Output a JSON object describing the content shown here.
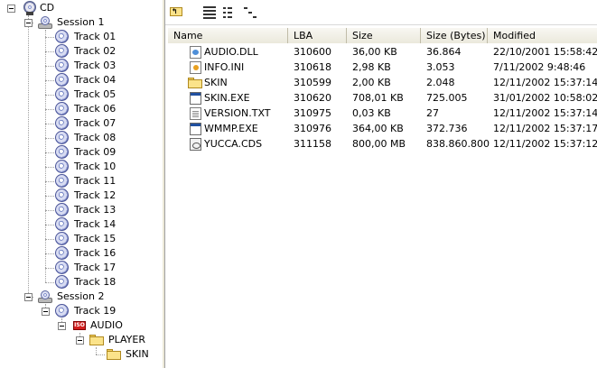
{
  "tree": {
    "root_label": "CD",
    "session1_label": "Session 1",
    "tracks": [
      "Track 01",
      "Track 02",
      "Track 03",
      "Track 04",
      "Track 05",
      "Track 06",
      "Track 07",
      "Track 08",
      "Track 09",
      "Track 10",
      "Track 11",
      "Track 12",
      "Track 13",
      "Track 14",
      "Track 15",
      "Track 16",
      "Track 17",
      "Track 18"
    ],
    "session2_label": "Session 2",
    "track19_label": "Track 19",
    "iso_badge": "ISO",
    "audio_label": "AUDIO",
    "player_label": "PLAYER",
    "skin_label": "SKIN"
  },
  "toolbar": {
    "up_icon": "folder-up-icon",
    "details_icon": "details-view-icon",
    "list_icon": "list-view-icon",
    "tree_icon": "tree-view-icon"
  },
  "columns": [
    "Name",
    "LBA",
    "Size",
    "Size (Bytes)",
    "Modified"
  ],
  "files": [
    {
      "name": "AUDIO.DLL",
      "lba": "310600",
      "size": "36,00 KB",
      "bytes": "36.864",
      "modified": "22/10/2001 15:58:42",
      "icon": "dll"
    },
    {
      "name": "INFO.INI",
      "lba": "310618",
      "size": "2,98 KB",
      "bytes": "3.053",
      "modified": "7/11/2002 9:48:46",
      "icon": "ini"
    },
    {
      "name": "SKIN",
      "lba": "310599",
      "size": "2,00 KB",
      "bytes": "2.048",
      "modified": "12/11/2002 15:37:14",
      "icon": "folder"
    },
    {
      "name": "SKIN.EXE",
      "lba": "310620",
      "size": "708,01 KB",
      "bytes": "725.005",
      "modified": "31/01/2002 10:58:02",
      "icon": "exe"
    },
    {
      "name": "VERSION.TXT",
      "lba": "310975",
      "size": "0,03 KB",
      "bytes": "27",
      "modified": "12/11/2002 15:37:14",
      "icon": "doc"
    },
    {
      "name": "WMMP.EXE",
      "lba": "310976",
      "size": "364,00 KB",
      "bytes": "372.736",
      "modified": "12/11/2002 15:37:17",
      "icon": "exe"
    },
    {
      "name": "YUCCA.CDS",
      "lba": "311158",
      "size": "800,00 MB",
      "bytes": "838.860.800",
      "modified": "12/11/2002 15:37:12",
      "icon": "cds"
    }
  ]
}
